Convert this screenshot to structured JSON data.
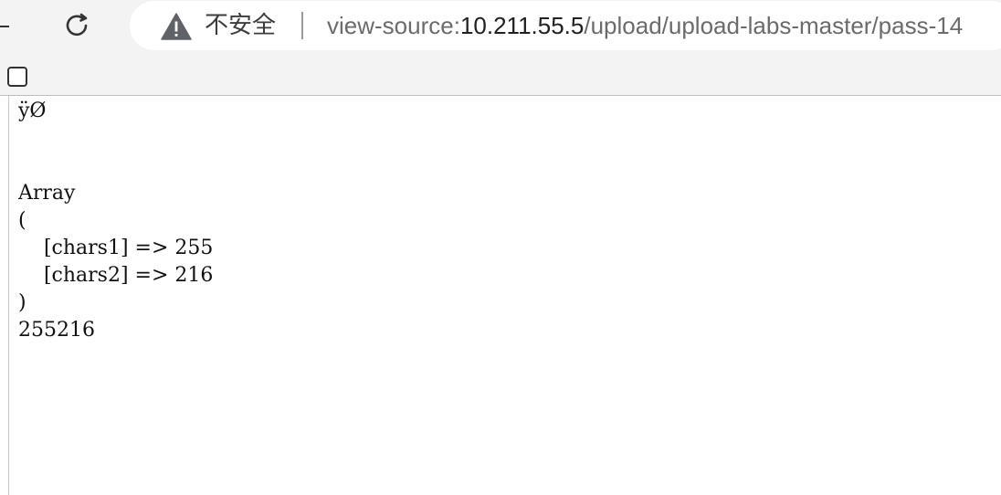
{
  "browser": {
    "security_label": "不安全",
    "url_prefix": "view-source:",
    "url_host": "10.211.55.5",
    "url_path": "/upload/upload-labs-master/pass-14"
  },
  "source_lines": [
    "ÿØ",
    "",
    "",
    "Array",
    "(",
    "    [chars1] => 255",
    "    [chars2] => 216",
    ")",
    "255216"
  ]
}
